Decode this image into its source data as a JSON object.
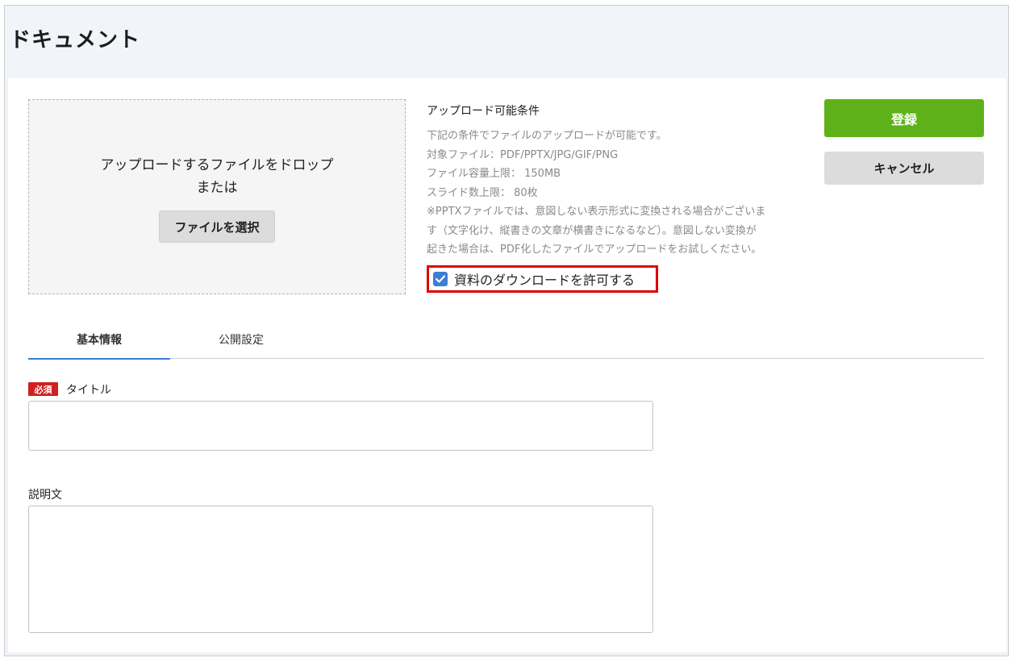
{
  "header": {
    "title": "ドキュメント"
  },
  "upload": {
    "drop_text": "アップロードするファイルをドロップ",
    "or_text": "または",
    "select_button": "ファイルを選択"
  },
  "conditions": {
    "title": "アップロード可能条件",
    "lines": [
      "下記の条件でファイルのアップロードが可能です。",
      "対象ファイル：PDF/PPTX/JPG/GIF/PNG",
      "ファイル容量上限： 150MB",
      "スライド数上限： 80枚",
      "※PPTXファイルでは、意図しない表示形式に変換される場合がございま",
      "す（文字化け、縦書きの文章が横書きになるなど）。意図しない変換が",
      "起きた場合は、PDF化したファイルでアップロードをお試しください。"
    ],
    "allow_download_label": "資料のダウンロードを許可する",
    "allow_download_checked": true
  },
  "actions": {
    "register": "登録",
    "cancel": "キャンセル"
  },
  "tabs": [
    {
      "label": "基本情報",
      "active": true
    },
    {
      "label": "公開設定",
      "active": false
    }
  ],
  "form": {
    "required_badge": "必須",
    "title_label": "タイトル",
    "title_value": "",
    "description_label": "説明文",
    "description_value": ""
  },
  "colors": {
    "accent": "#3b7dd8",
    "register": "#5fb11a",
    "required": "#d21f1f",
    "highlight": "#e00000"
  }
}
